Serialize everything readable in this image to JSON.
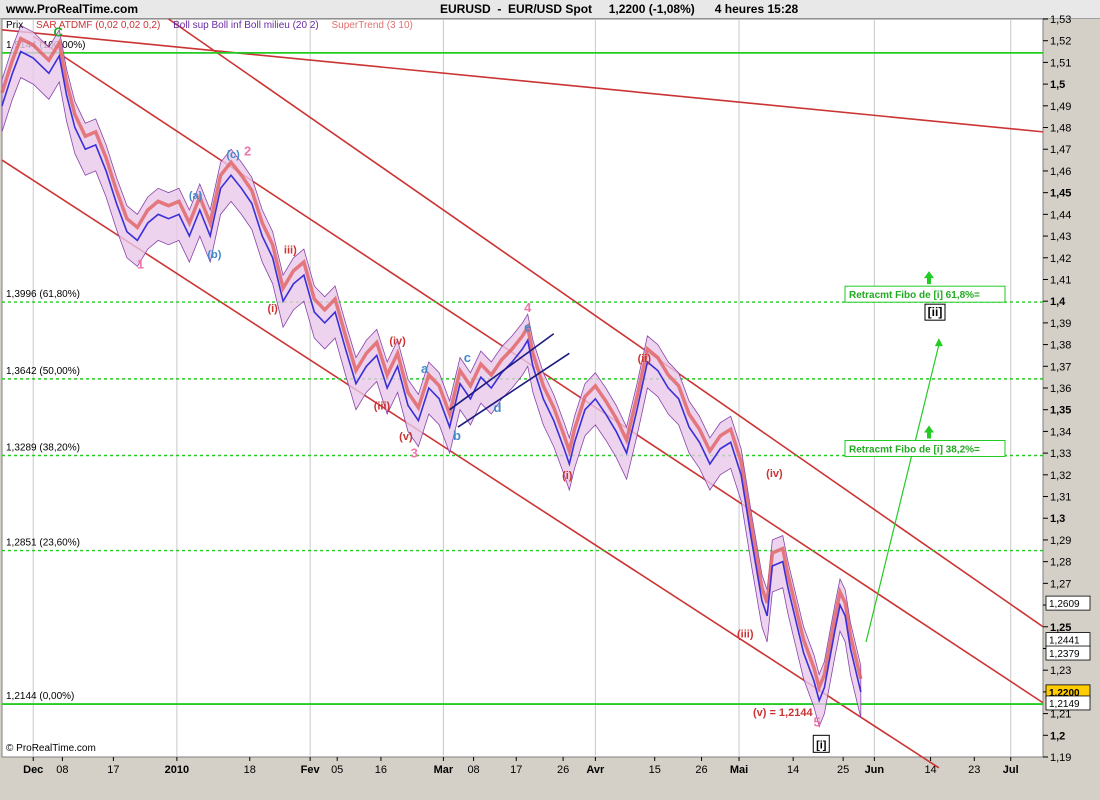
{
  "header": {
    "site": "www.ProRealTime.com",
    "symbol": "EURUSD",
    "instrument": "EUR/USD Spot",
    "price": "1,2200",
    "change": "(-1,08%)",
    "timeframe": "4 heures",
    "time": "15:28"
  },
  "legend": [
    {
      "label": "Prix",
      "color": "#000000"
    },
    {
      "label": "SAR ATDMF (0,02 0,02 0,2)",
      "color": "#cc3333"
    },
    {
      "label": "Boll sup Boll inf Boll milieu (20 2)",
      "color": "#6a2aa0"
    },
    {
      "label": "SuperTrend (3 10)",
      "color": "#e07070"
    }
  ],
  "footer": "© ProRealTime.com",
  "colors": {
    "background": "#ffffff",
    "price": "#3a2fd8",
    "fibo": "#22cc22",
    "channel": "#cc3333",
    "bollinger": "#8844aa",
    "band_fill": "#e8c8e8",
    "supertrend": "#e06060"
  },
  "chart_data": {
    "type": "line",
    "ylim": [
      1.19,
      1.53
    ],
    "y_ticks": [
      1.53,
      1.52,
      1.51,
      1.5,
      1.49,
      1.48,
      1.47,
      1.46,
      1.45,
      1.44,
      1.43,
      1.42,
      1.41,
      1.4,
      1.39,
      1.38,
      1.37,
      1.36,
      1.35,
      1.34,
      1.33,
      1.32,
      1.31,
      1.3,
      1.29,
      1.28,
      1.27,
      1.26,
      1.25,
      1.24,
      1.23,
      1.22,
      1.21,
      1.2,
      1.19
    ],
    "y_tick_labels": [
      "1,53",
      "1,52",
      "1,51",
      "1,5",
      "1,49",
      "1,48",
      "1,47",
      "1,46",
      "1,45",
      "1,44",
      "1,43",
      "1,42",
      "1,41",
      "1,4",
      "1,39",
      "1,38",
      "1,37",
      "1,36",
      "1,35",
      "1,34",
      "1,33",
      "1,32",
      "1,31",
      "1,3",
      "1,29",
      "1,28",
      "1,27",
      "1,26",
      "1,25",
      "1,24",
      "1,23",
      "1,22",
      "1,21",
      "1,2",
      "1,19"
    ],
    "y_bold": [
      1.5,
      1.45,
      1.4,
      1.35,
      1.3,
      1.25,
      1.2
    ],
    "x_ticks": [
      {
        "label": "Dec",
        "t": 0.03
      },
      {
        "label": "08",
        "t": 0.058
      },
      {
        "label": "17",
        "t": 0.107
      },
      {
        "label": "2010",
        "t": 0.168
      },
      {
        "label": "18",
        "t": 0.238
      },
      {
        "label": "Fev",
        "t": 0.296
      },
      {
        "label": "05",
        "t": 0.322
      },
      {
        "label": "16",
        "t": 0.364
      },
      {
        "label": "Mar",
        "t": 0.424
      },
      {
        "label": "08",
        "t": 0.453
      },
      {
        "label": "17",
        "t": 0.494
      },
      {
        "label": "26",
        "t": 0.539
      },
      {
        "label": "Avr",
        "t": 0.57
      },
      {
        "label": "15",
        "t": 0.627
      },
      {
        "label": "26",
        "t": 0.672
      },
      {
        "label": "Mai",
        "t": 0.708
      },
      {
        "label": "14",
        "t": 0.76
      },
      {
        "label": "25",
        "t": 0.808
      },
      {
        "label": "Jun",
        "t": 0.838
      },
      {
        "label": "14",
        "t": 0.892
      },
      {
        "label": "23",
        "t": 0.934
      },
      {
        "label": "Jul",
        "t": 0.969
      }
    ],
    "x_bold": [
      "Dec",
      "2010",
      "Fev",
      "Mar",
      "Avr",
      "Mai",
      "Jun",
      "Jul"
    ],
    "price_series": [
      [
        0.0,
        1.49
      ],
      [
        0.01,
        1.505
      ],
      [
        0.018,
        1.515
      ],
      [
        0.03,
        1.512
      ],
      [
        0.045,
        1.505
      ],
      [
        0.055,
        1.513
      ],
      [
        0.062,
        1.495
      ],
      [
        0.07,
        1.48
      ],
      [
        0.08,
        1.47
      ],
      [
        0.09,
        1.472
      ],
      [
        0.1,
        1.46
      ],
      [
        0.11,
        1.445
      ],
      [
        0.12,
        1.432
      ],
      [
        0.13,
        1.428
      ],
      [
        0.14,
        1.436
      ],
      [
        0.15,
        1.44
      ],
      [
        0.16,
        1.438
      ],
      [
        0.17,
        1.44
      ],
      [
        0.18,
        1.43
      ],
      [
        0.19,
        1.442
      ],
      [
        0.2,
        1.43
      ],
      [
        0.21,
        1.452
      ],
      [
        0.22,
        1.458
      ],
      [
        0.23,
        1.452
      ],
      [
        0.24,
        1.445
      ],
      [
        0.25,
        1.43
      ],
      [
        0.26,
        1.42
      ],
      [
        0.27,
        1.4
      ],
      [
        0.28,
        1.408
      ],
      [
        0.29,
        1.412
      ],
      [
        0.3,
        1.395
      ],
      [
        0.31,
        1.39
      ],
      [
        0.32,
        1.395
      ],
      [
        0.33,
        1.378
      ],
      [
        0.34,
        1.362
      ],
      [
        0.35,
        1.37
      ],
      [
        0.36,
        1.375
      ],
      [
        0.37,
        1.36
      ],
      [
        0.38,
        1.37
      ],
      [
        0.39,
        1.352
      ],
      [
        0.4,
        1.345
      ],
      [
        0.41,
        1.36
      ],
      [
        0.42,
        1.355
      ],
      [
        0.43,
        1.342
      ],
      [
        0.44,
        1.362
      ],
      [
        0.45,
        1.355
      ],
      [
        0.46,
        1.365
      ],
      [
        0.47,
        1.36
      ],
      [
        0.48,
        1.367
      ],
      [
        0.49,
        1.372
      ],
      [
        0.5,
        1.378
      ],
      [
        0.505,
        1.382
      ],
      [
        0.51,
        1.37
      ],
      [
        0.52,
        1.355
      ],
      [
        0.53,
        1.345
      ],
      [
        0.54,
        1.332
      ],
      [
        0.545,
        1.325
      ],
      [
        0.55,
        1.335
      ],
      [
        0.56,
        1.35
      ],
      [
        0.57,
        1.355
      ],
      [
        0.58,
        1.348
      ],
      [
        0.59,
        1.34
      ],
      [
        0.6,
        1.33
      ],
      [
        0.61,
        1.35
      ],
      [
        0.62,
        1.372
      ],
      [
        0.63,
        1.368
      ],
      [
        0.64,
        1.36
      ],
      [
        0.65,
        1.355
      ],
      [
        0.66,
        1.342
      ],
      [
        0.67,
        1.335
      ],
      [
        0.68,
        1.325
      ],
      [
        0.69,
        1.332
      ],
      [
        0.7,
        1.335
      ],
      [
        0.71,
        1.32
      ],
      [
        0.72,
        1.29
      ],
      [
        0.73,
        1.262
      ],
      [
        0.735,
        1.255
      ],
      [
        0.74,
        1.278
      ],
      [
        0.75,
        1.28
      ],
      [
        0.755,
        1.268
      ],
      [
        0.76,
        1.258
      ],
      [
        0.77,
        1.238
      ],
      [
        0.78,
        1.225
      ],
      [
        0.785,
        1.216
      ],
      [
        0.79,
        1.222
      ],
      [
        0.8,
        1.248
      ],
      [
        0.805,
        1.26
      ],
      [
        0.81,
        1.255
      ],
      [
        0.815,
        1.24
      ],
      [
        0.82,
        1.23
      ],
      [
        0.825,
        1.22
      ]
    ],
    "fibonacci_levels": [
      {
        "label": "1,5",
        "value": 1.5144,
        "display": "1,51"
      },
      {
        "label": "1,3996 (61,80%)",
        "value": 1.3996
      },
      {
        "label": "1,3642 (50,00%)",
        "value": 1.3642
      },
      {
        "label": "1,3289 (38,20%)",
        "value": 1.3289
      },
      {
        "label": "1,2851 (23,60%)",
        "value": 1.2851
      },
      {
        "label": "1,2144 (0,00%)",
        "value": 1.2144
      }
    ],
    "top_fibo_label": "1,5144 (100,00%)",
    "price_tags": [
      {
        "label": "1,2609",
        "value": 1.2609
      },
      {
        "label": "1,2441",
        "value": 1.2441
      },
      {
        "label": "1,2379",
        "value": 1.2379
      },
      {
        "label": "1,2200",
        "value": 1.22,
        "highlight": true
      },
      {
        "label": "1,2149",
        "value": 1.2149
      }
    ],
    "retracement_boxes": [
      {
        "label": "Retracmt Fibo de [i] 61,8%=",
        "value": 1.4,
        "wave": "[ii]"
      },
      {
        "label": "Retracmt Fibo de [i] 38,2%=",
        "value": 1.3289
      }
    ],
    "wave_labels": [
      {
        "text": "C",
        "t": 0.054,
        "y": 1.522,
        "color": "#22aa22"
      },
      {
        "text": "1",
        "t": 0.133,
        "y": 1.415,
        "color": "#ee77aa"
      },
      {
        "text": "(a)",
        "t": 0.186,
        "y": 1.447,
        "color": "#4488cc"
      },
      {
        "text": "(b)",
        "t": 0.204,
        "y": 1.42,
        "color": "#4488cc"
      },
      {
        "text": "(c)",
        "t": 0.222,
        "y": 1.466,
        "color": "#4488cc"
      },
      {
        "text": "2",
        "t": 0.236,
        "y": 1.467,
        "color": "#ee77aa"
      },
      {
        "text": "iii)",
        "t": 0.277,
        "y": 1.422,
        "color": "#cc3333"
      },
      {
        "text": "(i)",
        "t": 0.26,
        "y": 1.395,
        "color": "#cc3333"
      },
      {
        "text": "(iv)",
        "t": 0.38,
        "y": 1.38,
        "color": "#cc3333"
      },
      {
        "text": "(iii)",
        "t": 0.365,
        "y": 1.35,
        "color": "#cc3333"
      },
      {
        "text": "(v)",
        "t": 0.388,
        "y": 1.336,
        "color": "#cc3333"
      },
      {
        "text": "3",
        "t": 0.396,
        "y": 1.328,
        "color": "#ee77aa"
      },
      {
        "text": "a",
        "t": 0.406,
        "y": 1.367,
        "color": "#4488cc"
      },
      {
        "text": "b",
        "t": 0.437,
        "y": 1.336,
        "color": "#4488cc"
      },
      {
        "text": "c",
        "t": 0.447,
        "y": 1.372,
        "color": "#4488cc"
      },
      {
        "text": "d",
        "t": 0.476,
        "y": 1.349,
        "color": "#4488cc"
      },
      {
        "text": "e",
        "t": 0.505,
        "y": 1.386,
        "color": "#4488cc"
      },
      {
        "text": "4",
        "t": 0.505,
        "y": 1.395,
        "color": "#ee77aa"
      },
      {
        "text": "(i)",
        "t": 0.543,
        "y": 1.318,
        "color": "#cc3333"
      },
      {
        "text": "(ii)",
        "t": 0.617,
        "y": 1.372,
        "color": "#cc3333"
      },
      {
        "text": "(iv)",
        "t": 0.742,
        "y": 1.319,
        "color": "#cc3333"
      },
      {
        "text": "(iii)",
        "t": 0.714,
        "y": 1.245,
        "color": "#cc3333"
      },
      {
        "text": "(v) = 1,2144",
        "t": 0.75,
        "y": 1.209,
        "color": "#cc3333"
      },
      {
        "text": "5",
        "t": 0.783,
        "y": 1.204,
        "color": "#ee77aa"
      },
      {
        "text": "[i]",
        "t": 0.787,
        "y": 1.194,
        "color": "#000000",
        "boxed": true
      }
    ]
  }
}
